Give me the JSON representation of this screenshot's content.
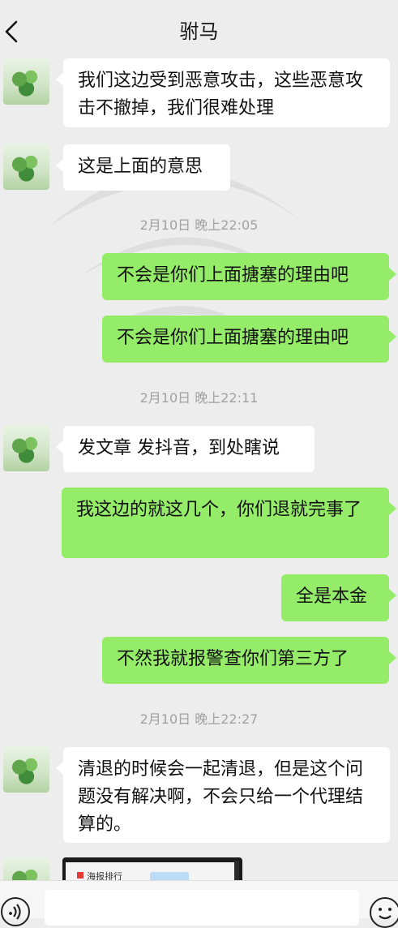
{
  "header": {
    "title": "驸马",
    "back_icon": "chevron-left-icon"
  },
  "messages": [
    {
      "side": "left",
      "text": "我们这边受到恶意攻击，这些恶意攻击不撤掉，我们很难处理"
    },
    {
      "side": "left",
      "text": "这是上面的意思"
    },
    {
      "type": "timestamp",
      "text": "2月10日 晚上22:05"
    },
    {
      "side": "right",
      "text": "不会是你们上面搪塞的理由吧"
    },
    {
      "side": "right",
      "text": "不会是你们上面搪塞的理由吧"
    },
    {
      "type": "timestamp",
      "text": "2月10日 晚上22:11"
    },
    {
      "side": "left",
      "text": "发文章 发抖音，到处瞎说"
    },
    {
      "side": "right",
      "text": "我这边的就这几个，你们退就完事了"
    },
    {
      "side": "right",
      "text": "全是本金"
    },
    {
      "side": "right",
      "text": "不然我就报警查你们第三方了"
    },
    {
      "type": "timestamp",
      "text": "2月10日 晚上22:27"
    },
    {
      "side": "left",
      "text": "清退的时候会一起清退，但是这个问题没有解决啊，不会只给一个代理结算的。"
    },
    {
      "side": "left",
      "type": "image",
      "caption": "海报排行"
    }
  ],
  "input": {
    "voice_icon": "voice-icon",
    "emoji_icon": "emoji-icon",
    "placeholder": ""
  },
  "colors": {
    "background": "#ededed",
    "sent_bubble": "#95ec69",
    "received_bubble": "#ffffff"
  }
}
